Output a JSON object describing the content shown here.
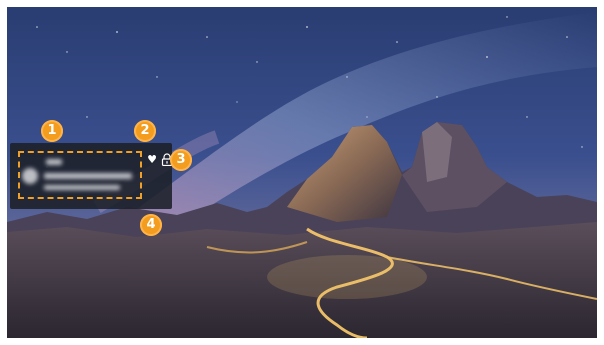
{
  "colors": {
    "marker": "#f49c1e",
    "dashed_outline": "#f0a024",
    "panel": "#1c2028"
  },
  "info_panel": {
    "content_blurred": true,
    "icons": [
      "heart-icon",
      "lock-icon"
    ]
  },
  "callouts": [
    "1",
    "2",
    "3",
    "4"
  ]
}
